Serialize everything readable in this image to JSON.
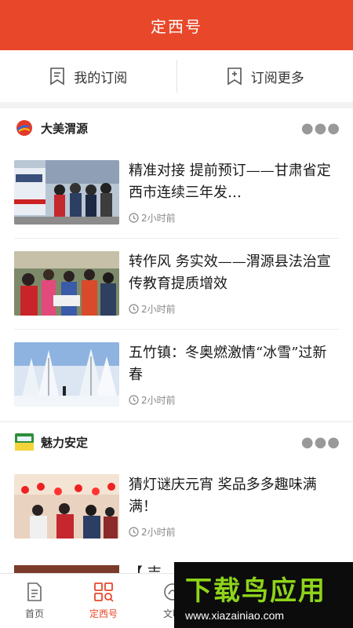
{
  "header": {
    "title": "定西号"
  },
  "subnav": {
    "my_subscriptions": "我的订阅",
    "subscribe_more": "订阅更多"
  },
  "sections": [
    {
      "name": "大美渭源",
      "logo_icon": "daimei-weiyuan-logo-icon",
      "items": [
        {
          "headline": "精准对接  提前预订——甘肃省定西市连续三年发…",
          "time": "2小时前"
        },
        {
          "headline": "转作风  务实效——渭源县法治宣传教育提质增效",
          "time": "2小时前"
        },
        {
          "headline": "五竹镇：冬奥燃激情“冰雪”过新春",
          "time": "2小时前"
        }
      ]
    },
    {
      "name": "魅力安定",
      "logo_icon": "meili-anding-logo-icon",
      "items": [
        {
          "headline": "猜灯谜庆元宵    奖品多多趣味满满！",
          "time": "2小时前"
        }
      ]
    }
  ],
  "peek_item": {
    "headline": "【 吉"
  },
  "tabbar": {
    "tabs": [
      {
        "label": "首页"
      },
      {
        "label": "定西号"
      },
      {
        "label": "文明"
      }
    ]
  },
  "watermark": {
    "main": "下载鸟应用",
    "url": "www.xiazainiao.com"
  },
  "colors": {
    "brand": "#e8472a",
    "watermark_green": "#8ed41a"
  }
}
